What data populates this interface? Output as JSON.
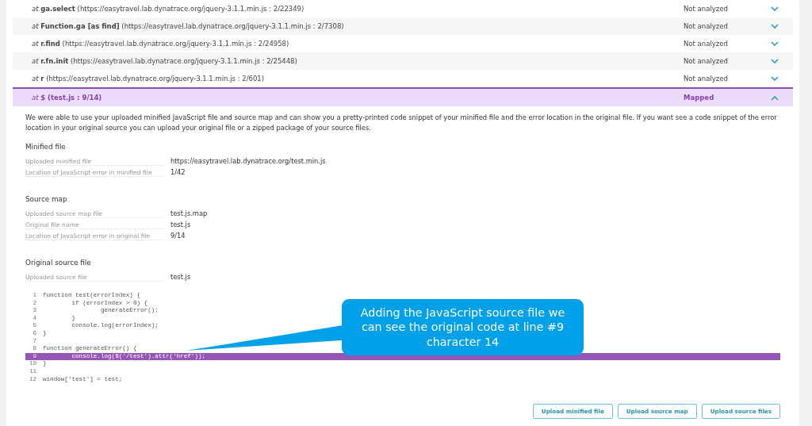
{
  "frames": [
    {
      "text": "*at* **ga.select** (https://easytravel.lab.dynatrace.org/jquery-3.1.1.min.js : 2/22349)",
      "status": "Not analyzed",
      "expanded": false,
      "selected": false
    },
    {
      "text": "*at* **Function.ga [as find]** (https://easytravel.lab.dynatrace.org/jquery-3.1.1.min.js : 2/7308)",
      "status": "Not analyzed",
      "expanded": false,
      "selected": false
    },
    {
      "text": "*at* **r.find** (https://easytravel.lab.dynatrace.org/jquery-3.1.1.min.js : 2/24958)",
      "status": "Not analyzed",
      "expanded": false,
      "selected": false
    },
    {
      "text": "*at* **r.fn.init** (https://easytravel.lab.dynatrace.org/jquery-3.1.1.min.js : 2/25448)",
      "status": "Not analyzed",
      "expanded": false,
      "selected": false
    },
    {
      "text": "*at* **r** (https://easytravel.lab.dynatrace.org/jquery-3.1.1.min.js : 2/601)",
      "status": "Not analyzed",
      "expanded": false,
      "selected": false
    },
    {
      "text": "*at* **$ (test.js : 9/14)**",
      "status": "Mapped",
      "expanded": true,
      "selected": true
    }
  ],
  "intro": "We were able to use your uploaded minified JavaScript file and source map and can show you a pretty-printed code snippet of your minified file and the error location in the original file. If you want see a code snippet of the error location in your original source you can upload your original file or a zipped package of your source files.",
  "sections": [
    {
      "title": "Minified file",
      "fields": [
        {
          "label": "Uploaded minified file",
          "value": "https://easytravel.lab.dynatrace.org/test.min.js"
        },
        {
          "label": "Location of JavaScript error in minified file",
          "value": "1/42"
        }
      ]
    },
    {
      "title": "Source map",
      "fields": [
        {
          "label": "Uploaded source map file",
          "value": "test.js.map"
        },
        {
          "label": "Original file name",
          "value": "test.js"
        },
        {
          "label": "Location of JavaScript error in original file",
          "value": "9/14"
        }
      ]
    },
    {
      "title": "Original source file",
      "fields": [
        {
          "label": "Uploaded source file",
          "value": "test.js"
        }
      ]
    }
  ],
  "code": [
    {
      "number": "1",
      "code": "function test(errorIndex) {",
      "selected": false
    },
    {
      "number": "2",
      "code": "        if (errorIndex > 0) {",
      "selected": false
    },
    {
      "number": "3",
      "code": "                generateError();",
      "selected": false
    },
    {
      "number": "4",
      "code": "        }",
      "selected": false
    },
    {
      "number": "5",
      "code": "        console.log(errorIndex);",
      "selected": false
    },
    {
      "number": "6",
      "code": "}",
      "selected": false
    },
    {
      "number": "7",
      "selected": false
    },
    {
      "number": "8",
      "code": "function generateError() {",
      "selected": false
    },
    {
      "number": "9",
      "code": "        console.log($('/test').attr('href'));",
      "selected": true
    },
    {
      "number": "10",
      "code": "}",
      "selected": false
    },
    {
      "number": "11",
      "selected": false
    },
    {
      "number": "12",
      "code": "window['test'] = test;",
      "selected": false
    }
  ],
  "callout": "Adding the JavaScript source file we can see the original code at line #9 character 14",
  "buttons": [
    "Upload minified file",
    "Upload source map",
    "Upload source files"
  ]
}
